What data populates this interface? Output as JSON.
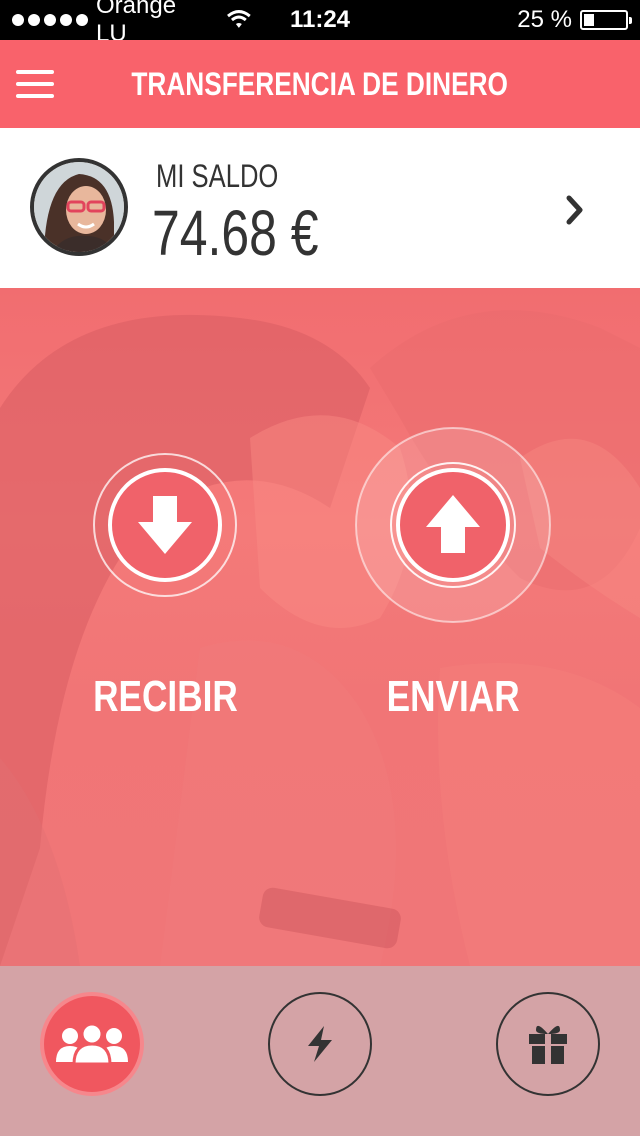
{
  "status_bar": {
    "carrier": "Orange LU",
    "time": "11:24",
    "battery_percent_label": "25 %",
    "battery_level": 0.25
  },
  "nav": {
    "title": "TRANSFERENCIA DE DINERO",
    "menu_icon": "hamburger-icon"
  },
  "balance": {
    "label": "MI SALDO",
    "value": "74.68 €",
    "chevron_icon": "chevron-right-icon"
  },
  "actions": {
    "receive": {
      "label": "RECIBIR",
      "icon": "arrow-down-icon"
    },
    "send": {
      "label": "ENVIAR",
      "icon": "arrow-up-icon"
    }
  },
  "tabs": [
    {
      "name": "contacts",
      "icon": "group-icon",
      "active": true
    },
    {
      "name": "flash",
      "icon": "lightning-icon",
      "active": false
    },
    {
      "name": "gifts",
      "icon": "gift-icon",
      "active": false
    }
  ],
  "colors": {
    "brand": "#f9626b",
    "active_tab": "#f0575f",
    "tab_bar": "#d4a3a6",
    "text_dark": "#333333"
  }
}
